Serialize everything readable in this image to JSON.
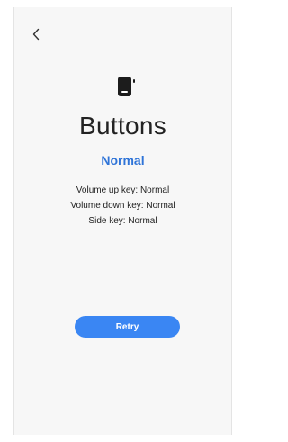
{
  "header": {
    "back_icon": "chevron-left-icon"
  },
  "hero": {
    "icon": "phone-side-buttons-icon",
    "title": "Buttons",
    "status": "Normal",
    "status_color": "#2f74d8"
  },
  "results": [
    {
      "label": "Volume up key: Normal"
    },
    {
      "label": "Volume down key: Normal"
    },
    {
      "label": "Side key: Normal"
    }
  ],
  "actions": {
    "retry_label": "Retry",
    "retry_color": "#3a86f3"
  }
}
